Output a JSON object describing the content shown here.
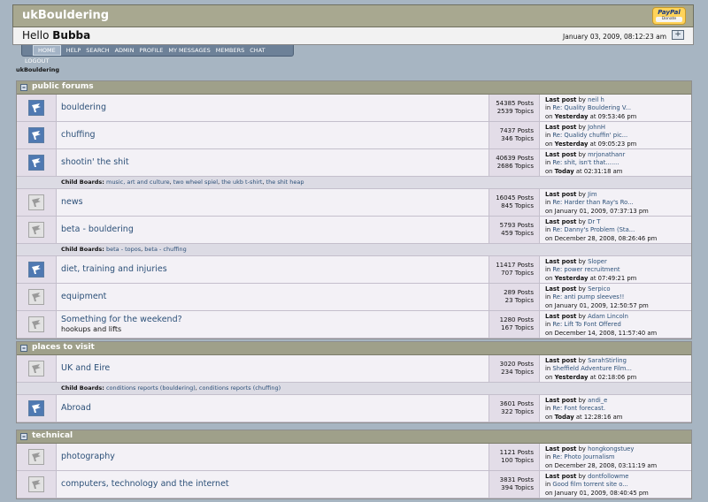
{
  "site": {
    "title": "ukBouldering",
    "paypal_top": "PayPal",
    "paypal_bottom": "Donate"
  },
  "user": {
    "greeting": "Hello",
    "name": "Bubba",
    "date": "January 03, 2009, 08:12:23 am",
    "collapse": "+"
  },
  "nav": [
    "HOME",
    "HELP",
    "SEARCH",
    "ADMIN",
    "PROFILE",
    "MY MESSAGES",
    "MEMBERS",
    "CHAT",
    "LOGOUT"
  ],
  "breadcrumb": "ukBouldering",
  "labels": {
    "last_post": "Last post",
    "by": "by",
    "in": "in",
    "on": "on",
    "child_boards": "Child Boards:"
  },
  "categories": [
    {
      "title": "public forums",
      "forums": [
        {
          "name": "bouldering",
          "posts": "54385 Posts",
          "topics": "2539 Topics",
          "lp_by": "neil h",
          "lp_in": "Re: Quality Bouldering V...",
          "lp_day": "Yesterday",
          "lp_time": "at 09:53:46 pm",
          "new": true
        },
        {
          "name": "chuffing",
          "posts": "7437 Posts",
          "topics": "346 Topics",
          "lp_by": "JohnH",
          "lp_in": "Re: Qualidy chuffin' pic...",
          "lp_day": "Yesterday",
          "lp_time": "at 09:05:23 pm",
          "new": true
        },
        {
          "name": "shootin' the shit",
          "posts": "40639 Posts",
          "topics": "2686 Topics",
          "lp_by": "mrjonathanr",
          "lp_in": "Re: shit, isn't that.......",
          "lp_day": "Today",
          "lp_time": "at 02:31:18 am",
          "new": true,
          "children": [
            "music, art and culture",
            "two wheel spiel",
            "the ukb t-shirt",
            "the shit heap"
          ]
        },
        {
          "name": "news",
          "posts": "16045 Posts",
          "topics": "845 Topics",
          "lp_by": "Jim",
          "lp_in": "Re: Harder than Ray's Ro...",
          "lp_day": "",
          "lp_time": "January 01, 2009, 07:37:13 pm",
          "new": false
        },
        {
          "name": "beta - bouldering",
          "posts": "5793 Posts",
          "topics": "459 Topics",
          "lp_by": "Dr T",
          "lp_in": "Re: Danny's Problem (Sta...",
          "lp_day": "",
          "lp_time": "December 28, 2008, 08:26:46 pm",
          "new": false,
          "children": [
            "beta - topos",
            "beta - chuffing"
          ]
        },
        {
          "name": "diet, training and injuries",
          "posts": "11417 Posts",
          "topics": "707 Topics",
          "lp_by": "Sloper",
          "lp_in": "Re: power recruitment",
          "lp_day": "Yesterday",
          "lp_time": "at 07:49:21 pm",
          "new": true
        },
        {
          "name": "equipment",
          "posts": "289 Posts",
          "topics": "23 Topics",
          "lp_by": "Serpico",
          "lp_in": "Re: anti pump sleeves!!",
          "lp_day": "",
          "lp_time": "January 01, 2009, 12:50:57 pm",
          "new": false
        },
        {
          "name": "Something for the weekend?",
          "desc": "hookups and lifts",
          "posts": "1280 Posts",
          "topics": "167 Topics",
          "lp_by": "Adam Lincoln",
          "lp_in": "Re: Lift To Font Offered",
          "lp_day": "",
          "lp_time": "December 14, 2008, 11:57:40 am",
          "new": false
        }
      ]
    },
    {
      "title": "places to visit",
      "forums": [
        {
          "name": "UK and Eire",
          "posts": "3020 Posts",
          "topics": "234 Topics",
          "lp_by": "SarahStirling",
          "lp_in": "Sheffield Adventure Film...",
          "lp_day": "Yesterday",
          "lp_time": "at 02:18:06 pm",
          "new": false,
          "children": [
            "conditions reports (bouldering)",
            "conditions reports (chuffing)"
          ]
        },
        {
          "name": "Abroad",
          "posts": "3601 Posts",
          "topics": "322 Topics",
          "lp_by": "andi_e",
          "lp_in": "Re: Font forecast.",
          "lp_day": "Today",
          "lp_time": "at 12:28:16 am",
          "new": true
        }
      ]
    },
    {
      "title": "technical",
      "forums": [
        {
          "name": "photography",
          "posts": "1121 Posts",
          "topics": "100 Topics",
          "lp_by": "hongkongstuey",
          "lp_in": "Re: Photo Journalism",
          "lp_day": "",
          "lp_time": "December 28, 2008, 03:11:19 am",
          "new": false
        },
        {
          "name": "computers, technology and the internet",
          "posts": "3831 Posts",
          "topics": "394 Topics",
          "lp_by": "dontfollowme",
          "lp_in": "Good film torrent site o...",
          "lp_day": "",
          "lp_time": "January 01, 2009, 08:40:45 pm",
          "new": false
        }
      ]
    }
  ]
}
